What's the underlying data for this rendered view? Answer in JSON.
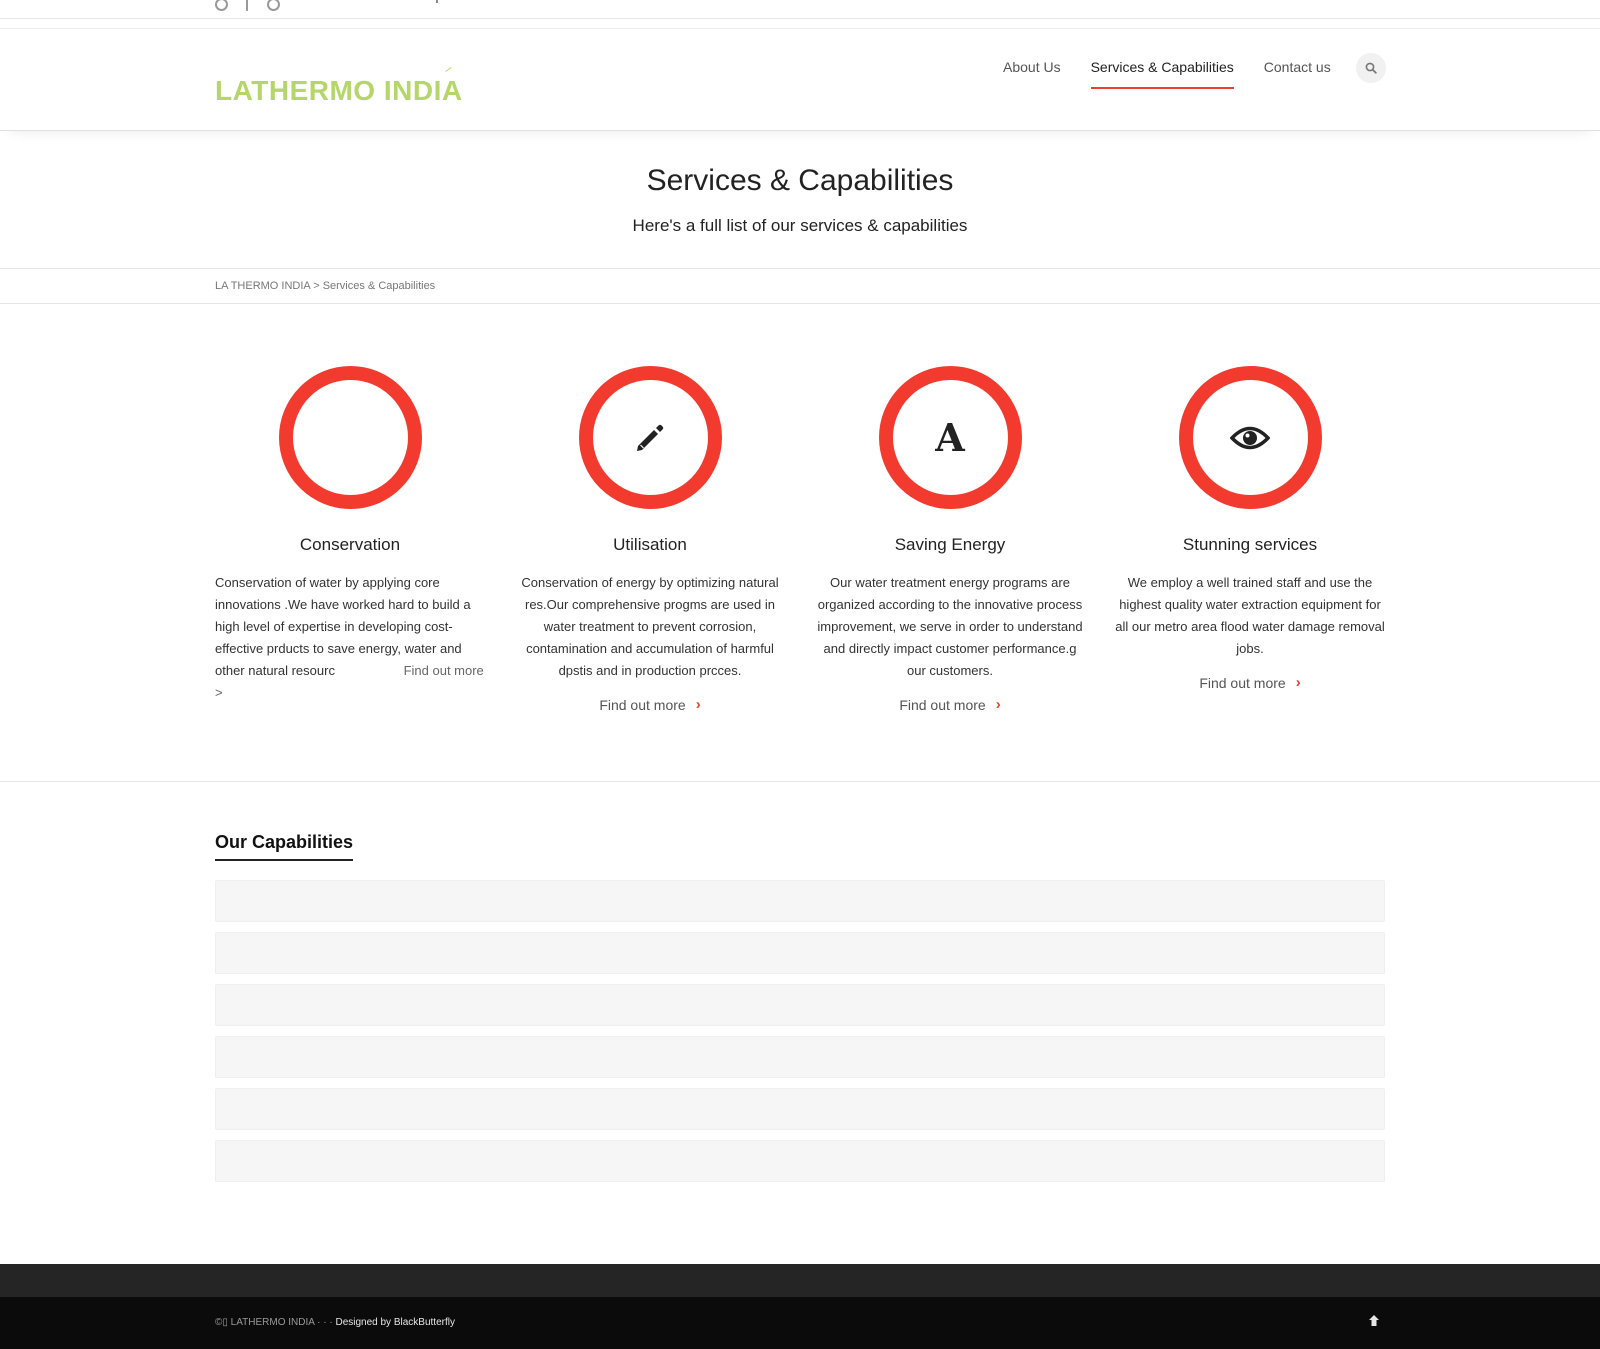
{
  "brand": {
    "logo_text": "LATHERMO INDIA",
    "logo_color": "#b5d66a",
    "accent_color": "#f23a2e"
  },
  "nav": {
    "items": [
      {
        "label": "About Us"
      },
      {
        "label": "Services & Capabilities",
        "active": true
      },
      {
        "label": "Contact us"
      }
    ],
    "search_icon": "search-icon"
  },
  "page": {
    "title": "Services & Capabilities",
    "subtitle": "Here's a full list of our services & capabilities"
  },
  "breadcrumb": {
    "text": "LA THERMO INDIA > Services & Capabilities"
  },
  "services": [
    {
      "title": "Conservation",
      "icon": "empty",
      "text": "Conservation of water by applying core innovations .We have worked hard to build a high level of expertise in developing cost-effective prducts to save energy, water and other natural resourc",
      "link": "Find out more >"
    },
    {
      "title": "Utilisation",
      "icon": "pencil-icon",
      "text": "Conservation of energy by optimizing natural res.Our comprehensive progms are used in water treatment to prevent corrosion, contamination and accumulation of harmful dpstis and in production prcces.",
      "link": "Find out more"
    },
    {
      "title": "Saving Energy",
      "icon": "font-icon",
      "icon_glyph": "A",
      "text": "Our water treatment energy programs are organized according to the innovative process improvement, we serve in order to understand and directly impact customer performance.g our customers.",
      "link": "Find out more"
    },
    {
      "title": "Stunning services",
      "icon": "eye-icon",
      "text": "We employ a well trained staff and use the highest quality water extraction equipment for all our metro area flood water damage removal jobs.",
      "link": "Find out more"
    }
  ],
  "capabilities": {
    "heading": "Our Capabilities",
    "rows": [
      "",
      "",
      "",
      "",
      "",
      ""
    ]
  },
  "footer": {
    "copyright": "©▯ LATHERMO INDIA · · · ",
    "designed_by": "Designed by BlackButterfly",
    "to_top_icon": "arrow-up-icon"
  }
}
